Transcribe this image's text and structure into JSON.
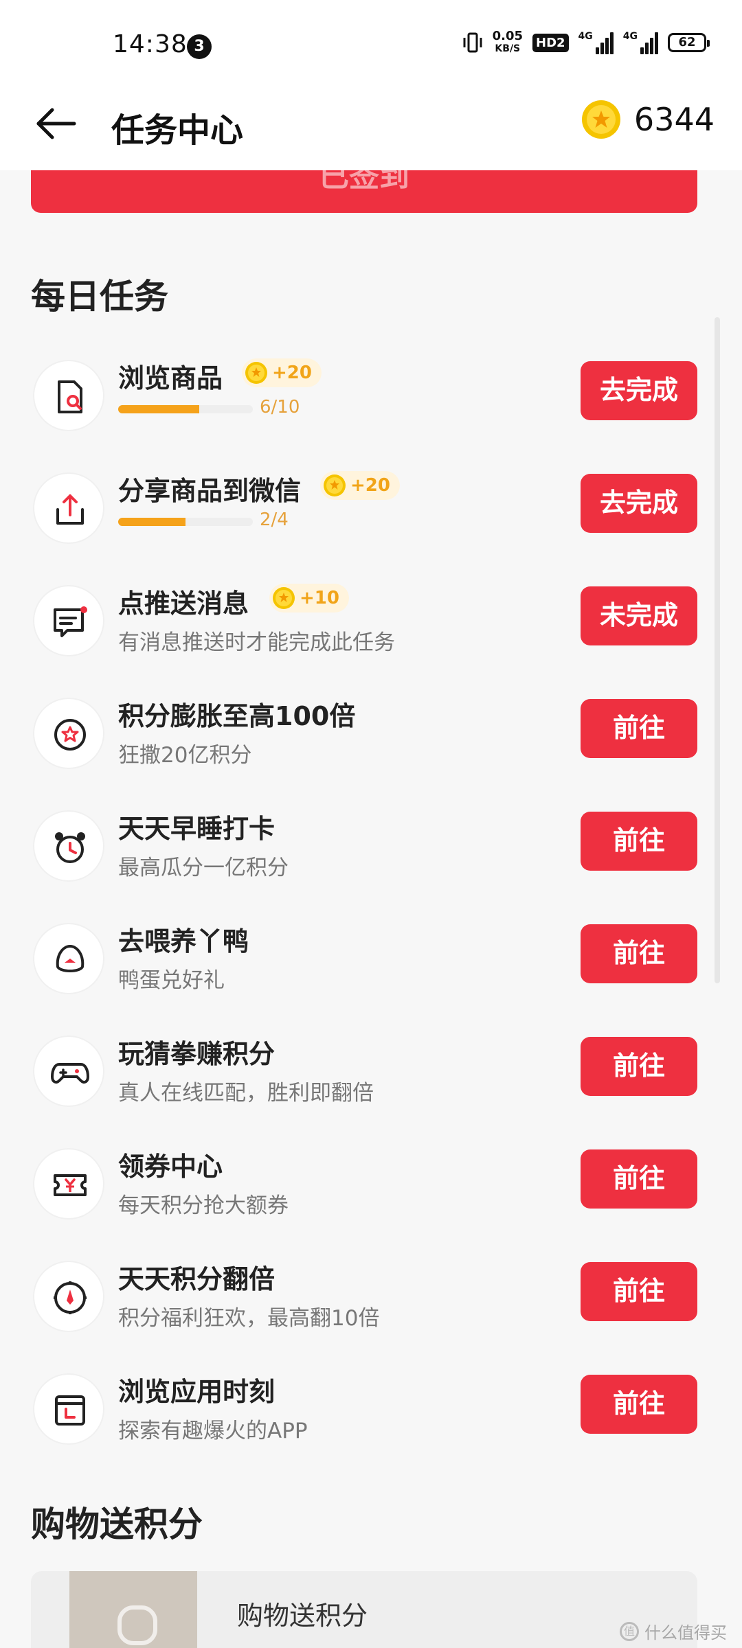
{
  "status_bar": {
    "time": "14:38",
    "notification_count": "3",
    "net_speed_value": "0.05",
    "net_speed_unit": "KB/S",
    "hd_badge": "HD2",
    "net_type_1": "4G",
    "net_type_2": "4G",
    "battery": "62"
  },
  "header": {
    "title": "任务中心",
    "coin_balance": "6344"
  },
  "signin_bar": {
    "label": "已签到"
  },
  "daily": {
    "title": "每日任务",
    "tasks": [
      {
        "title": "浏览商品",
        "reward": "+20",
        "progress_text": "6/10",
        "progress": 0.6,
        "button": "去完成",
        "icon": "search-product-icon"
      },
      {
        "title": "分享商品到微信",
        "reward": "+20",
        "progress_text": "2/4",
        "progress": 0.5,
        "button": "去完成",
        "icon": "share-icon"
      },
      {
        "title": "点推送消息",
        "reward": "+10",
        "subtitle": "有消息推送时才能完成此任务",
        "button": "未完成",
        "icon": "message-icon"
      },
      {
        "title": "积分膨胀至高100倍",
        "subtitle": "狂撒20亿积分",
        "button": "前往",
        "icon": "star-badge-icon"
      },
      {
        "title": "天天早睡打卡",
        "subtitle": "最高瓜分一亿积分",
        "button": "前往",
        "icon": "alarm-clock-icon"
      },
      {
        "title": "去喂养丫鸭",
        "subtitle": "鸭蛋兑好礼",
        "button": "前往",
        "icon": "duck-icon"
      },
      {
        "title": "玩猜拳赚积分",
        "subtitle": "真人在线匹配，胜利即翻倍",
        "button": "前往",
        "icon": "gamepad-icon"
      },
      {
        "title": "领券中心",
        "subtitle": "每天积分抢大额券",
        "button": "前往",
        "icon": "coupon-icon"
      },
      {
        "title": "天天积分翻倍",
        "subtitle": "积分福利狂欢，最高翻10倍",
        "button": "前往",
        "icon": "compass-icon"
      },
      {
        "title": "浏览应用时刻",
        "subtitle": "探索有趣爆火的APP",
        "button": "前往",
        "icon": "calendar-icon"
      }
    ]
  },
  "shopping": {
    "title": "购物送积分",
    "card_title": "购物送积分"
  },
  "watermark": {
    "text": "什么值得买",
    "logo": "值"
  },
  "colors": {
    "accent_red": "#ee3040",
    "coin_gold": "#f5c400",
    "reward_text": "#f1a419",
    "progress": "#f5a21a"
  }
}
